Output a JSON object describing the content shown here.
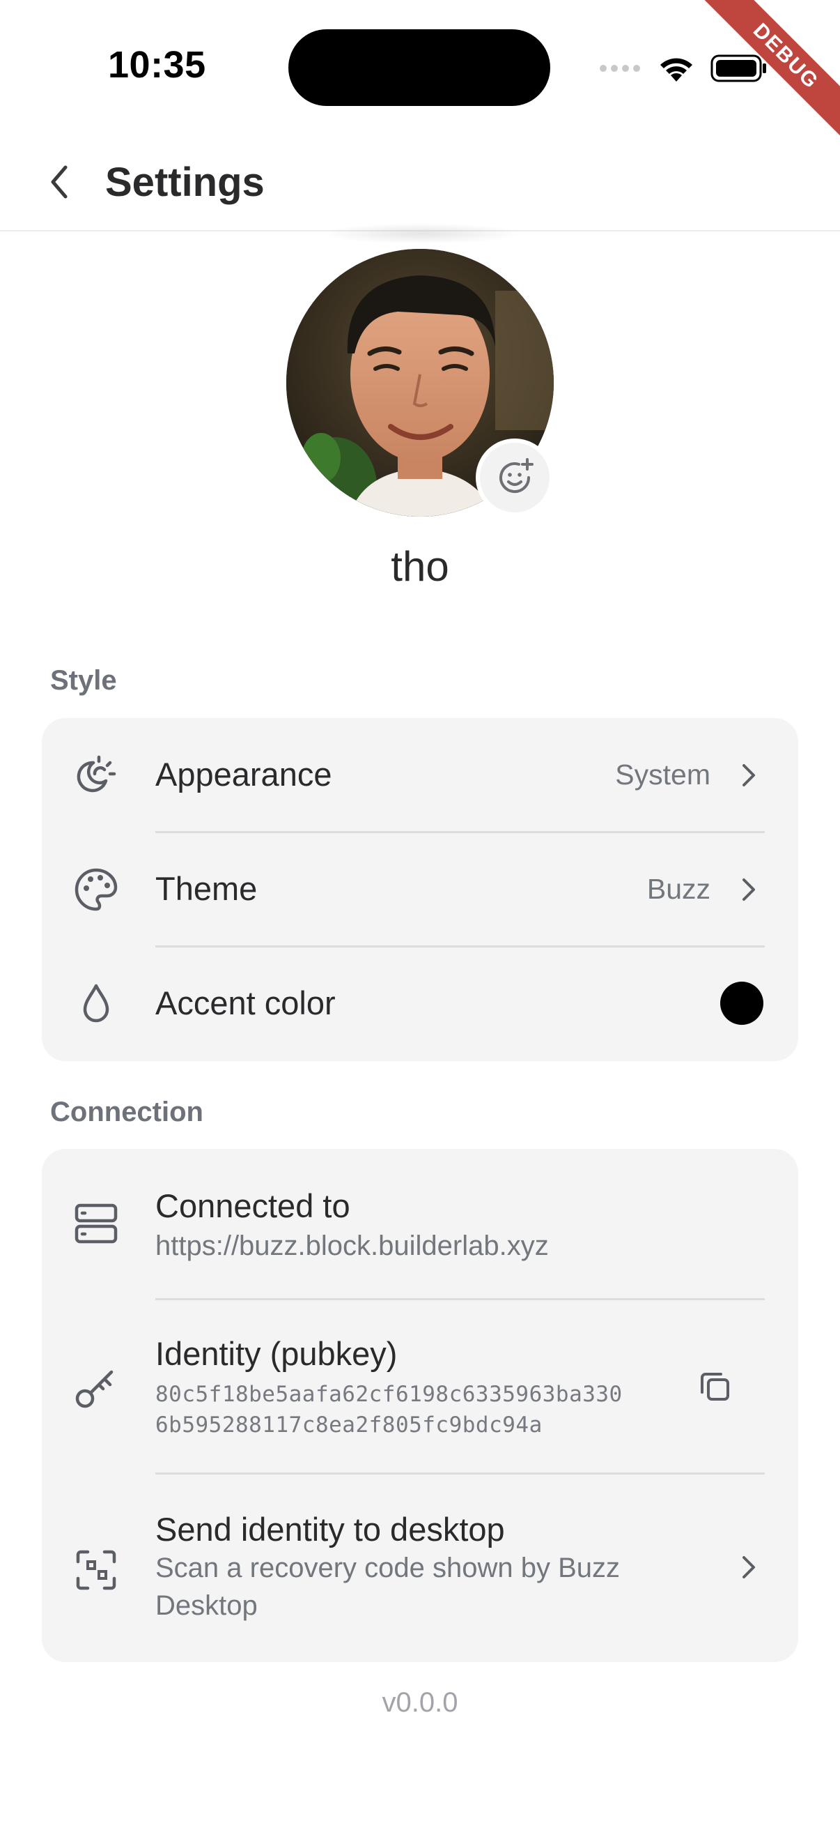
{
  "status_bar": {
    "time": "10:35",
    "debug_label": "DEBUG"
  },
  "header": {
    "title": "Settings"
  },
  "profile": {
    "username": "tho"
  },
  "style_section": {
    "label": "Style",
    "appearance": {
      "label": "Appearance",
      "value": "System"
    },
    "theme": {
      "label": "Theme",
      "value": "Buzz"
    },
    "accent": {
      "label": "Accent color",
      "color": "#000000"
    }
  },
  "connection_section": {
    "label": "Connection",
    "connected_to": {
      "label": "Connected to",
      "value": "https://buzz.block.builderlab.xyz"
    },
    "identity": {
      "label": "Identity (pubkey)",
      "pubkey_line1": "80c5f18be5aafa62cf6198c6335963ba330",
      "pubkey_line2": "6b595288117c8ea2f805fc9bdc94a"
    },
    "send_identity": {
      "label": "Send identity to desktop",
      "subtitle_line1": "Scan a recovery code shown by Buzz",
      "subtitle_line2": "Desktop"
    }
  },
  "footer": {
    "version": "v0.0.0"
  }
}
